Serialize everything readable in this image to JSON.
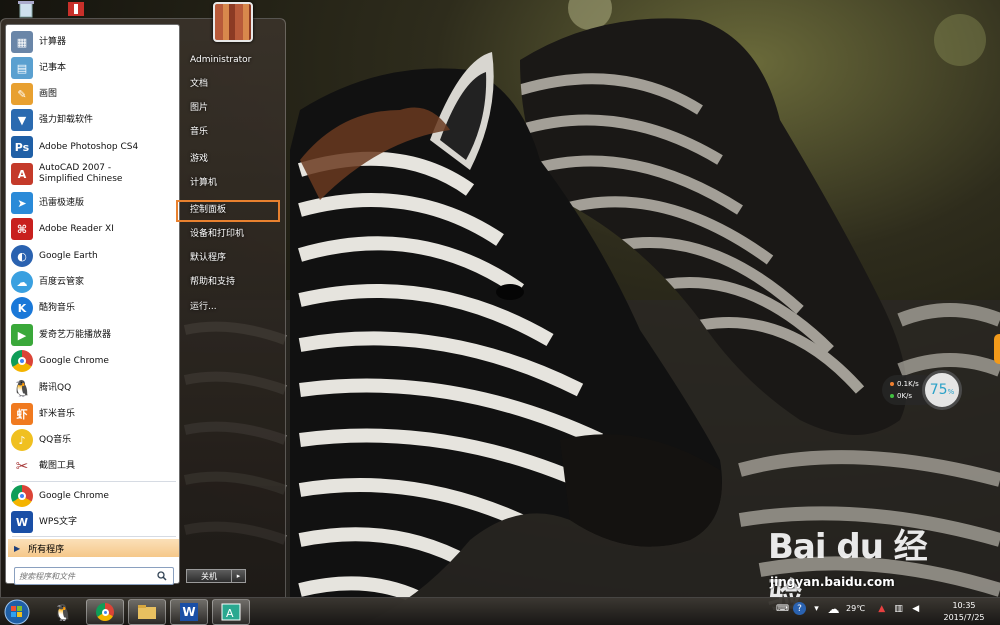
{
  "desktop": {
    "wallpaper_subject": "zebras",
    "icons": [
      "recycle-bin-icon",
      "app-shortcut-icon"
    ]
  },
  "start_menu": {
    "user_name": "Administrator",
    "programs": [
      {
        "label": "计算器",
        "icon": "calculator-icon",
        "color": "#6a86a8"
      },
      {
        "label": "记事本",
        "icon": "notepad-icon",
        "color": "#5aa0d0"
      },
      {
        "label": "画图",
        "icon": "paint-icon",
        "color": "#e8a030"
      },
      {
        "label": "强力卸载软件",
        "icon": "uninstaller-icon",
        "color": "#2a6ab0"
      },
      {
        "label": "Adobe Photoshop CS4",
        "icon": "photoshop-icon",
        "color": "#1f5fa6",
        "glyph": "Ps"
      },
      {
        "label": "AutoCAD 2007 - Simplified Chinese",
        "icon": "autocad-icon",
        "color": "#c43a2a"
      },
      {
        "label": "迅雷极速版",
        "icon": "thunder-icon",
        "color": "#2a8ad8"
      },
      {
        "label": "Adobe Reader XI",
        "icon": "adobe-reader-icon",
        "color": "#c8201e"
      },
      {
        "label": "Google Earth",
        "icon": "google-earth-icon",
        "color": "#2a62b0"
      },
      {
        "label": "百度云管家",
        "icon": "baidu-cloud-icon",
        "color": "#3aa0e0"
      },
      {
        "label": "酷狗音乐",
        "icon": "kugou-icon",
        "color": "#1a78d8",
        "glyph": "K"
      },
      {
        "label": "爱奇艺万能播放器",
        "icon": "iqiyi-icon",
        "color": "#3aa83a"
      },
      {
        "label": "Google Chrome",
        "icon": "chrome-icon",
        "color": "#dd4b39"
      },
      {
        "label": "腾讯QQ",
        "icon": "qq-icon",
        "color": "#222222"
      },
      {
        "label": "虾米音乐",
        "icon": "xiami-icon",
        "color": "#f07a20",
        "glyph": "虾"
      },
      {
        "label": "QQ音乐",
        "icon": "qq-music-icon",
        "color": "#f0c020"
      },
      {
        "label": "截图工具",
        "icon": "snipping-tool-icon",
        "color": "#a83a3a"
      }
    ],
    "pinned_bottom": [
      {
        "label": "Google Chrome",
        "icon": "chrome-icon",
        "color": "#dd4b39"
      },
      {
        "label": "WPS文字",
        "icon": "wps-icon",
        "color": "#1a4fa6",
        "glyph": "W"
      }
    ],
    "all_programs": "所有程序",
    "search_placeholder": "搜索程序和文件",
    "right_items": [
      "Administrator",
      "文档",
      "图片",
      "音乐",
      "游戏",
      "计算机",
      "控制面板",
      "设备和打印机",
      "默认程序",
      "帮助和支持",
      "运行..."
    ],
    "highlighted_item": "控制面板",
    "shutdown_label": "关机",
    "shutdown_more": "▸"
  },
  "taskbar": {
    "pinned": [
      "qq-icon",
      "chrome-icon",
      "file-explorer-icon",
      "wps-writer-icon",
      "app-icon"
    ],
    "tray": {
      "weather_temp": "29℃",
      "time": "10:35",
      "date": "2015/7/25"
    }
  },
  "net_gadget": {
    "upload": "0.1K/s",
    "download": "0K/s",
    "percent": "75",
    "percent_unit": "%"
  },
  "watermark": {
    "logo": "Bai du 经验",
    "url": "jingyan.baidu.com"
  }
}
